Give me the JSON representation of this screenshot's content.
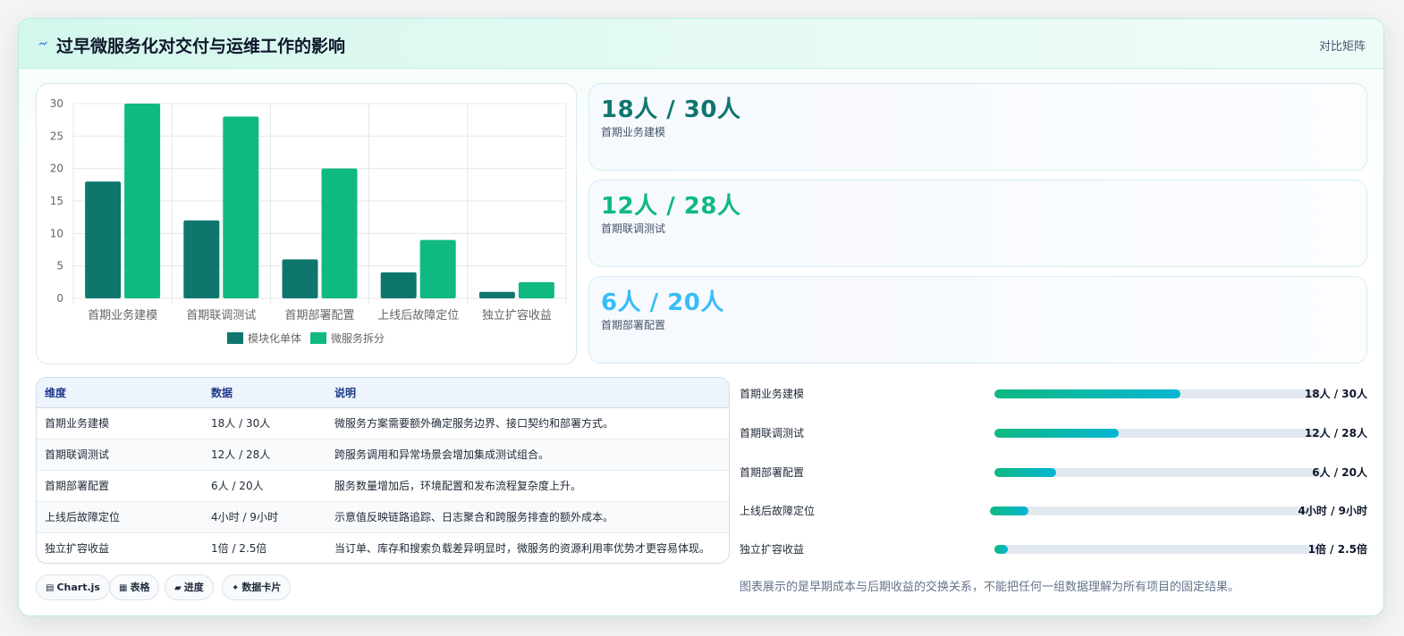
{
  "header": {
    "title": "过早微服务化对交付与运维工作的影响",
    "mode_label": "对比矩阵",
    "icon": "lightning-icon"
  },
  "chart_data": {
    "type": "bar",
    "categories": [
      "首期业务建模",
      "首期联调测试",
      "首期部署配置",
      "上线后故障定位",
      "独立扩容收益"
    ],
    "series": [
      {
        "name": "模块化单体",
        "values": [
          18,
          12,
          6,
          4,
          1
        ],
        "color": "#0f766e"
      },
      {
        "name": "微服务拆分",
        "values": [
          30,
          28,
          20,
          9,
          2.5
        ],
        "color": "#10b981"
      }
    ],
    "ylim": [
      0,
      30
    ],
    "yticks": [
      0,
      5,
      10,
      15,
      20,
      25,
      30
    ],
    "grid": true,
    "legend": "bottom"
  },
  "stats": [
    {
      "value": "18人 / 30人",
      "label": "首期业务建模",
      "color": "#0f766e"
    },
    {
      "value": "12人 / 28人",
      "label": "首期联调测试",
      "color": "#10b981"
    },
    {
      "value": "6人 / 20人",
      "label": "首期部署配置",
      "color": "#38bdf8"
    }
  ],
  "table": {
    "headers": [
      "维度",
      "数据",
      "说明"
    ],
    "rows": [
      [
        "首期业务建模",
        "18人 / 30人",
        "微服务方案需要额外确定服务边界、接口契约和部署方式。"
      ],
      [
        "首期联调测试",
        "12人 / 28人",
        "跨服务调用和异常场景会增加集成测试组合。"
      ],
      [
        "首期部署配置",
        "6人 / 20人",
        "服务数量增加后，环境配置和发布流程复杂度上升。"
      ],
      [
        "上线后故障定位",
        "4小时 / 9小时",
        "示意值反映链路追踪、日志聚合和跨服务排查的额外成本。"
      ],
      [
        "独立扩容收益",
        "1倍 / 2.5倍",
        "当订单、库存和搜索负载差异明显时，微服务的资源利用率优势才更容易体现。"
      ]
    ]
  },
  "progress": [
    {
      "label": "首期业务建模",
      "value": "18人 / 30人",
      "fraction": 0.57
    },
    {
      "label": "首期联调测试",
      "value": "12人 / 28人",
      "fraction": 0.38
    },
    {
      "label": "首期部署配置",
      "value": "6人 / 20人",
      "fraction": 0.19
    },
    {
      "label": "上线后故障定位",
      "value": "4小时 / 9小时",
      "fraction": 0.12
    },
    {
      "label": "独立扩容收益",
      "value": "1倍 / 2.5倍",
      "fraction": 0.04
    }
  ],
  "note": "图表展示的是早期成本与后期收益的交换关系，不能把任何一组数据理解为所有项目的固定结果。",
  "tags": [
    {
      "icon": "▤",
      "icon_name": "chart-icon",
      "label": "Chart.js"
    },
    {
      "icon": "▦",
      "icon_name": "table-icon",
      "label": "表格"
    },
    {
      "icon": "▰",
      "icon_name": "progress-icon",
      "label": "进度"
    },
    {
      "icon": "✦",
      "icon_name": "sparkle-icon",
      "label": "数据卡片"
    }
  ]
}
